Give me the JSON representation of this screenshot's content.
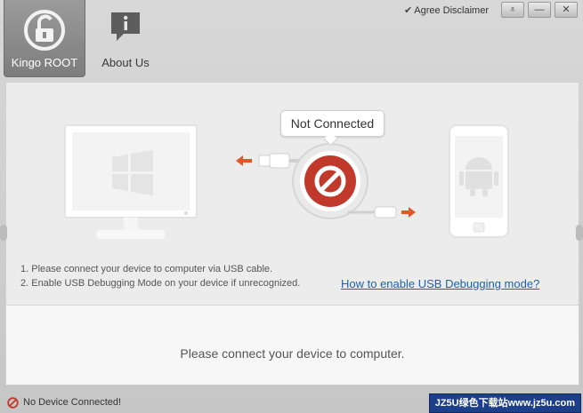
{
  "toolbar": {
    "kingo_root_label": "Kingo ROOT",
    "about_us_label": "About Us"
  },
  "topbar": {
    "agree_disclaimer": "Agree Disclaimer"
  },
  "connection": {
    "status_bubble": "Not Connected"
  },
  "instructions": {
    "step1": "1. Please connect your device to computer via USB cable.",
    "step2": "2. Enable USB Debugging Mode on your device if unrecognized.",
    "howto_link": "How to enable USB Debugging mode?"
  },
  "main": {
    "message": "Please connect your device to computer."
  },
  "statusbar": {
    "device_status": "No Device Connected!",
    "watermark": "JZ5U绿色下载站www.jz5u.com"
  },
  "colors": {
    "accent_red": "#c0392b",
    "link_blue": "#1f5fb5",
    "arrow_orange": "#e2572a"
  }
}
